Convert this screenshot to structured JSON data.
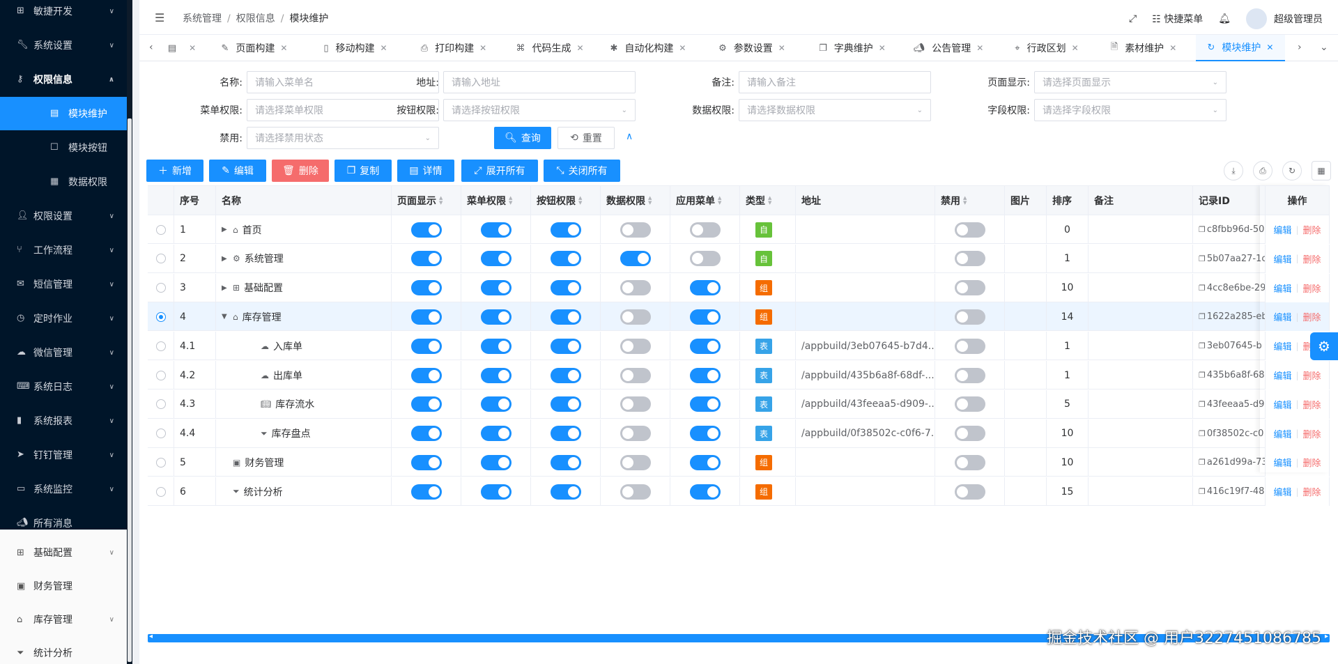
{
  "sidebar": {
    "items_top": [
      {
        "label": "敏捷开发",
        "icon": "grid-icon"
      },
      {
        "label": "系统设置",
        "icon": "wrench-icon"
      },
      {
        "label": "权限信息",
        "icon": "key-icon"
      },
      {
        "label": "模块维护",
        "icon": "doc-icon"
      },
      {
        "label": "模块按钮",
        "icon": "square-icon"
      },
      {
        "label": "数据权限",
        "icon": "table-icon"
      },
      {
        "label": "权限设置",
        "icon": "user-icon"
      },
      {
        "label": "工作流程",
        "icon": "branch-icon"
      },
      {
        "label": "短信管理",
        "icon": "sms-icon"
      },
      {
        "label": "定时作业",
        "icon": "clock-icon"
      },
      {
        "label": "微信管理",
        "icon": "wechat-icon"
      },
      {
        "label": "系统日志",
        "icon": "terminal-icon"
      },
      {
        "label": "系统报表",
        "icon": "chart-icon"
      },
      {
        "label": "钉钉管理",
        "icon": "dingtalk-icon"
      },
      {
        "label": "系统监控",
        "icon": "monitor-icon"
      },
      {
        "label": "所有消息",
        "icon": "megaphone-icon"
      }
    ],
    "items_bottom": [
      {
        "label": "基础配置",
        "icon": "grid-icon"
      },
      {
        "label": "财务管理",
        "icon": "finance-icon"
      },
      {
        "label": "库存管理",
        "icon": "bank-icon"
      },
      {
        "label": "统计分析",
        "icon": "funnel-icon"
      }
    ]
  },
  "header": {
    "breadcrumb": [
      "系统管理",
      "权限信息",
      "模块维护"
    ],
    "quick_menu": "快捷菜单",
    "user_name": "超级管理员"
  },
  "tabs": [
    {
      "label": "",
      "icon": "doc-icon"
    },
    {
      "label": "页面构建",
      "icon": "edit-icon"
    },
    {
      "label": "移动构建",
      "icon": "mobile-icon"
    },
    {
      "label": "打印构建",
      "icon": "printer-icon"
    },
    {
      "label": "代码生成",
      "icon": "code-icon"
    },
    {
      "label": "自动化构建",
      "icon": "bug-icon"
    },
    {
      "label": "参数设置",
      "icon": "gear-icon"
    },
    {
      "label": "字典维护",
      "icon": "copy-icon"
    },
    {
      "label": "公告管理",
      "icon": "megaphone-icon"
    },
    {
      "label": "行政区划",
      "icon": "location-icon"
    },
    {
      "label": "素材维护",
      "icon": "file-icon"
    },
    {
      "label": "模块维护",
      "icon": "refresh-icon"
    }
  ],
  "form": {
    "name": {
      "label": "名称:",
      "placeholder": "请输入菜单名"
    },
    "address": {
      "label": "地址:",
      "placeholder": "请输入地址"
    },
    "remark": {
      "label": "备注:",
      "placeholder": "请输入备注"
    },
    "page_display": {
      "label": "页面显示:",
      "placeholder": "请选择页面显示"
    },
    "menu_perm": {
      "label": "菜单权限:",
      "placeholder": "请选择菜单权限"
    },
    "button_perm": {
      "label": "按钮权限:",
      "placeholder": "请选择按钮权限"
    },
    "data_perm": {
      "label": "数据权限:",
      "placeholder": "请选择数据权限"
    },
    "field_perm": {
      "label": "字段权限:",
      "placeholder": "请选择字段权限"
    },
    "disabled": {
      "label": "禁用:",
      "placeholder": "请选择禁用状态"
    },
    "query": "查询",
    "reset": "重置"
  },
  "toolbar": {
    "add": "新增",
    "edit": "编辑",
    "delete": "删除",
    "copy": "复制",
    "detail": "详情",
    "expand_all": "展开所有",
    "collapse_all": "关闭所有"
  },
  "table": {
    "headers": {
      "seq": "序号",
      "name": "名称",
      "page_display": "页面显示",
      "menu_perm": "菜单权限",
      "button_perm": "按钮权限",
      "data_perm": "数据权限",
      "app_menu": "应用菜单",
      "type": "类型",
      "address": "地址",
      "disabled": "禁用",
      "image": "图片",
      "sort": "排序",
      "remark": "备注",
      "record_id": "记录ID",
      "ops": "操作"
    },
    "op_edit": "编辑",
    "op_delete": "删除",
    "rows": [
      {
        "seq": "1",
        "name": "首页",
        "icon": "home-icon",
        "level": 0,
        "expand": "right",
        "page": true,
        "menu": true,
        "button": true,
        "data": false,
        "app": false,
        "type": "自",
        "type_kind": "self",
        "address": "",
        "disabled": false,
        "sort": "0",
        "record_id": "c8fbb96d-50"
      },
      {
        "seq": "2",
        "name": "系统管理",
        "icon": "gear-icon",
        "level": 0,
        "expand": "right",
        "page": true,
        "menu": true,
        "button": true,
        "data": true,
        "app": false,
        "type": "自",
        "type_kind": "self",
        "address": "",
        "disabled": false,
        "sort": "1",
        "record_id": "5b07aa27-1c"
      },
      {
        "seq": "3",
        "name": "基础配置",
        "icon": "grid-icon",
        "level": 0,
        "expand": "right",
        "page": true,
        "menu": true,
        "button": true,
        "data": false,
        "app": true,
        "type": "组",
        "type_kind": "group",
        "address": "",
        "disabled": false,
        "sort": "10",
        "record_id": "4cc8e6be-29"
      },
      {
        "seq": "4",
        "name": "库存管理",
        "icon": "bank-icon",
        "level": 0,
        "expand": "down",
        "page": true,
        "menu": true,
        "button": true,
        "data": false,
        "app": true,
        "type": "组",
        "type_kind": "group",
        "address": "",
        "disabled": false,
        "sort": "14",
        "record_id": "1622a285-eb",
        "selected": true
      },
      {
        "seq": "4.1",
        "name": "入库单",
        "icon": "cloud-upload-icon",
        "level": 1,
        "expand": "",
        "page": true,
        "menu": true,
        "button": true,
        "data": false,
        "app": true,
        "type": "表",
        "type_kind": "table",
        "address": "/appbuild/3eb07645-b7d4...",
        "disabled": false,
        "sort": "1",
        "record_id": "3eb07645-b"
      },
      {
        "seq": "4.2",
        "name": "出库单",
        "icon": "cloud-upload-icon",
        "level": 1,
        "expand": "",
        "page": true,
        "menu": true,
        "button": true,
        "data": false,
        "app": true,
        "type": "表",
        "type_kind": "table",
        "address": "/appbuild/435b6a8f-68df-...",
        "disabled": false,
        "sort": "1",
        "record_id": "435b6a8f-68"
      },
      {
        "seq": "4.3",
        "name": "库存流水",
        "icon": "book-icon",
        "level": 1,
        "expand": "",
        "page": true,
        "menu": true,
        "button": true,
        "data": false,
        "app": true,
        "type": "表",
        "type_kind": "table",
        "address": "/appbuild/43feeaa5-d909-...",
        "disabled": false,
        "sort": "5",
        "record_id": "43feeaa5-d9"
      },
      {
        "seq": "4.4",
        "name": "库存盘点",
        "icon": "funnel-icon",
        "level": 1,
        "expand": "",
        "page": true,
        "menu": true,
        "button": true,
        "data": false,
        "app": true,
        "type": "表",
        "type_kind": "table",
        "address": "/appbuild/0f38502c-c0f6-7...",
        "disabled": false,
        "sort": "10",
        "record_id": "0f38502c-c0"
      },
      {
        "seq": "5",
        "name": "财务管理",
        "icon": "finance-icon",
        "level": 0,
        "expand": "",
        "page": true,
        "menu": true,
        "button": true,
        "data": false,
        "app": true,
        "type": "组",
        "type_kind": "group",
        "address": "",
        "disabled": false,
        "sort": "10",
        "record_id": "a261d99a-73"
      },
      {
        "seq": "6",
        "name": "统计分析",
        "icon": "funnel-icon",
        "level": 0,
        "expand": "",
        "page": true,
        "menu": true,
        "button": true,
        "data": false,
        "app": true,
        "type": "组",
        "type_kind": "group",
        "address": "",
        "disabled": false,
        "sort": "15",
        "record_id": "416c19f7-48"
      }
    ]
  },
  "watermark": "掘金技术社区 @ 用户3227451086785",
  "colors": {
    "primary": "#1890ff",
    "danger": "#f56c6c",
    "sidebar": "#001529"
  }
}
